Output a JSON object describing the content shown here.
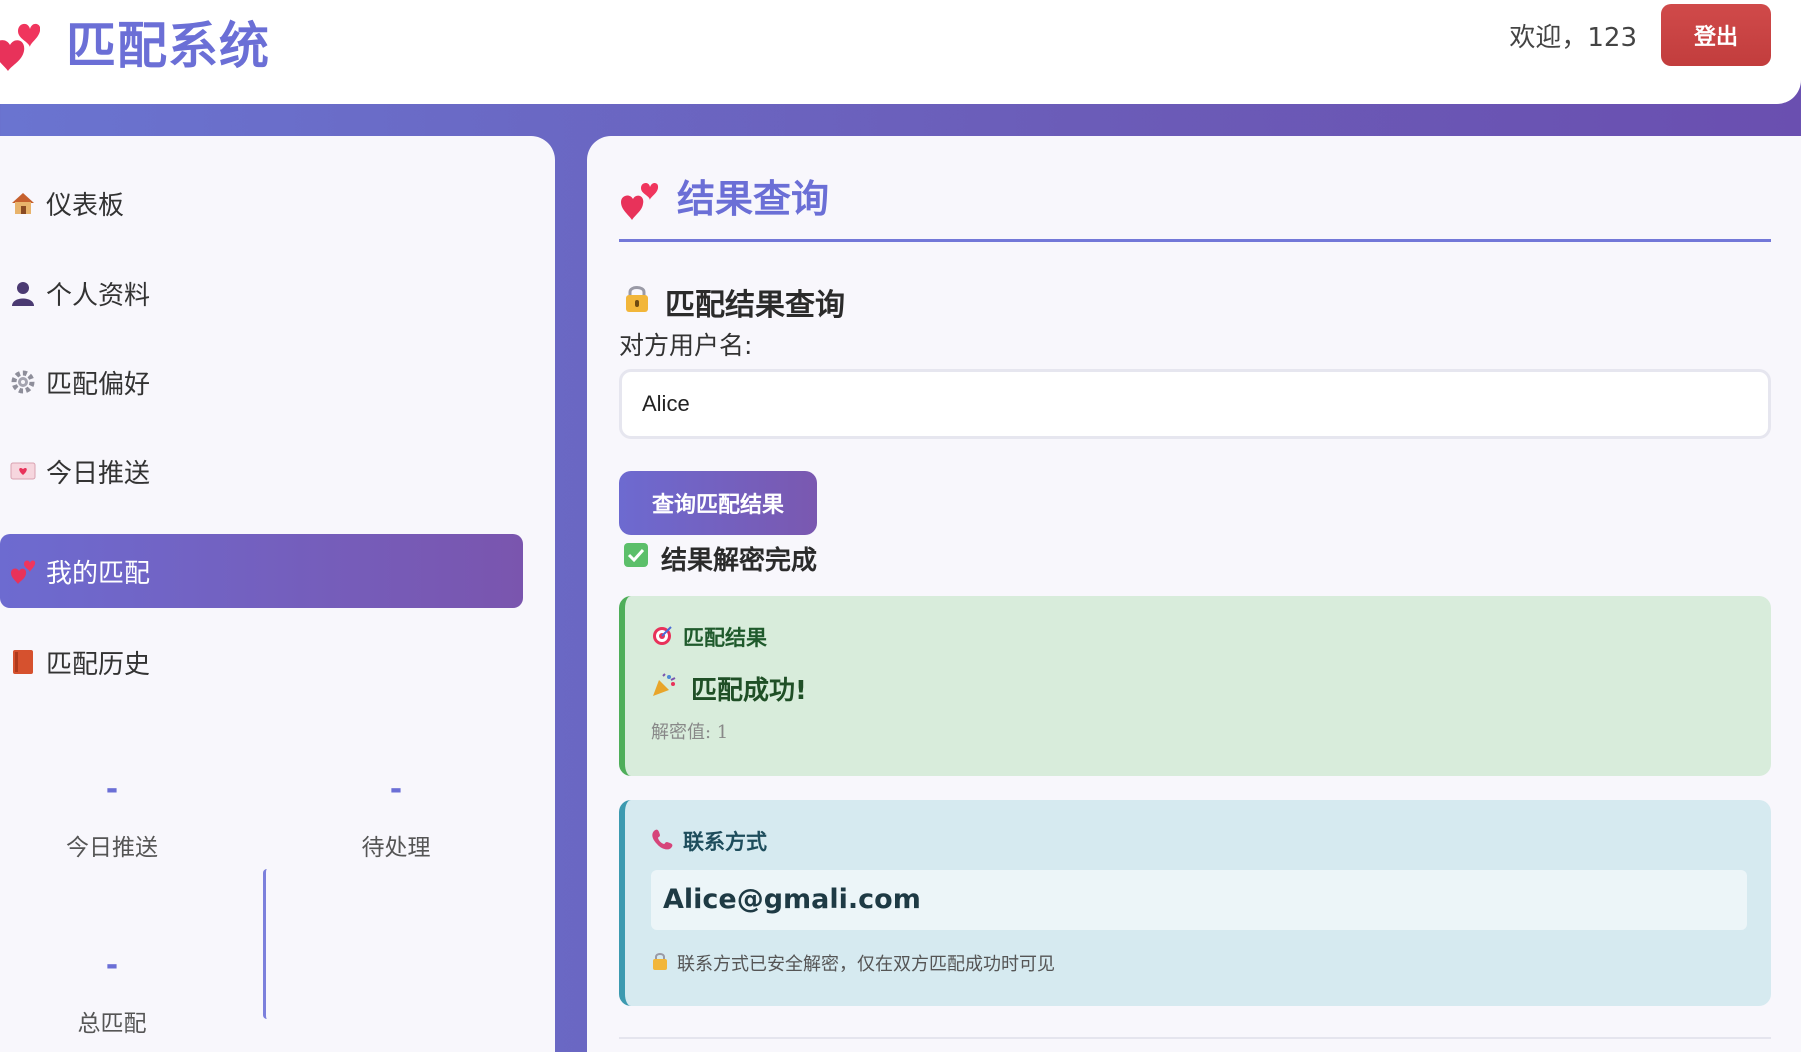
{
  "header": {
    "title": "匹配系统",
    "welcome": "欢迎，123",
    "logout_label": "登出"
  },
  "sidebar": {
    "items": [
      {
        "label": "仪表板",
        "icon": "house-icon"
      },
      {
        "label": "个人资料",
        "icon": "user-icon"
      },
      {
        "label": "匹配偏好",
        "icon": "gear-icon"
      },
      {
        "label": "今日推送",
        "icon": "love-letter-icon"
      },
      {
        "label": "我的匹配",
        "icon": "two-hearts-icon",
        "active": true
      },
      {
        "label": "匹配历史",
        "icon": "book-icon"
      }
    ],
    "stats": [
      {
        "value": "-",
        "label": "今日推送"
      },
      {
        "value": "-",
        "label": "待处理"
      },
      {
        "value": "-",
        "label": "总匹配"
      }
    ]
  },
  "main": {
    "section_title": "结果查询",
    "query_title": "匹配结果查询",
    "field_label": "对方用户名:",
    "username_value": "Alice",
    "query_button": "查询匹配结果",
    "status": "结果解密完成",
    "result": {
      "heading": "匹配结果",
      "message": "匹配成功!",
      "decrypt_value": "解密值: 1"
    },
    "contact": {
      "heading": "联系方式",
      "email": "Alice@gmali.com",
      "note": "联系方式已安全解密，仅在双方匹配成功时可见"
    }
  },
  "colors": {
    "accent": "#6b6fd6",
    "logout": "#c94141",
    "success_bg": "#d8ecdb",
    "success_border": "#4fae5a",
    "info_bg": "#d6eaf0",
    "info_border": "#3d9ab0"
  }
}
